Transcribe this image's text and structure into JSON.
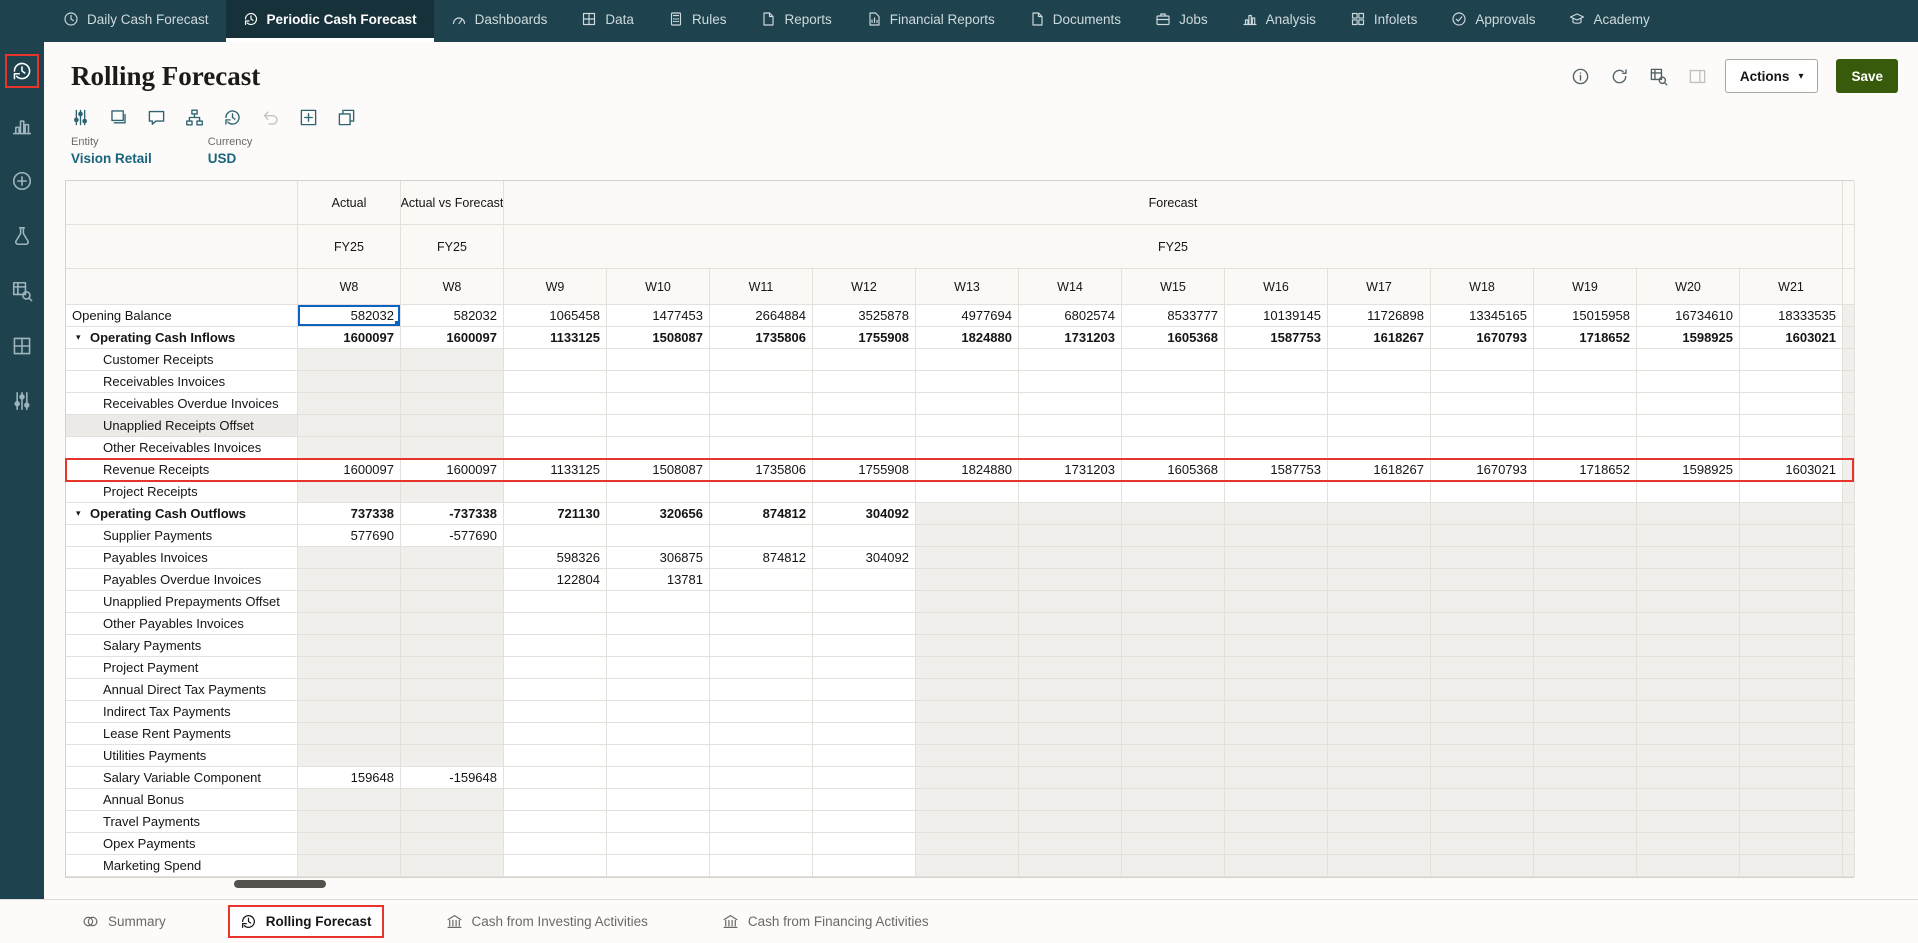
{
  "top_nav": {
    "tabs": [
      {
        "label": "Daily Cash Forecast",
        "icon": "daily-cash-clock"
      },
      {
        "label": "Periodic Cash Forecast",
        "icon": "periodic-cycle",
        "active": true
      },
      {
        "label": "Dashboards",
        "icon": "dashboards-gauge"
      },
      {
        "label": "Data",
        "icon": "data-grid"
      },
      {
        "label": "Rules",
        "icon": "rules-calculator"
      },
      {
        "label": "Reports",
        "icon": "reports-doc"
      },
      {
        "label": "Financial Reports",
        "icon": "financial-reports"
      },
      {
        "label": "Documents",
        "icon": "documents-doc"
      },
      {
        "label": "Jobs",
        "icon": "jobs-briefcase"
      },
      {
        "label": "Analysis",
        "icon": "analysis-chart"
      },
      {
        "label": "Infolets",
        "icon": "infolets-grid"
      },
      {
        "label": "Approvals",
        "icon": "approvals-check"
      },
      {
        "label": "Academy",
        "icon": "academy-cap"
      }
    ]
  },
  "rail": {
    "items": [
      {
        "icon": "rolling-forecast",
        "annotated": true
      },
      {
        "icon": "bar-chart"
      },
      {
        "icon": "data-plus"
      },
      {
        "icon": "rules-flask"
      },
      {
        "icon": "analysis-search"
      },
      {
        "icon": "table-grid"
      },
      {
        "icon": "tools-sliders"
      }
    ]
  },
  "header": {
    "title": "Rolling Forecast",
    "actions_label": "Actions",
    "save_label": "Save",
    "icons": [
      {
        "icon": "info"
      },
      {
        "icon": "refresh"
      },
      {
        "icon": "data-validation"
      },
      {
        "icon": "side-panel",
        "disabled": true
      }
    ]
  },
  "toolbar": {
    "icons": [
      {
        "icon": "adjust-columns"
      },
      {
        "icon": "layers"
      },
      {
        "icon": "comment"
      },
      {
        "icon": "hierarchy"
      },
      {
        "icon": "history"
      },
      {
        "icon": "undo",
        "disabled": true
      },
      {
        "icon": "expand-grid"
      },
      {
        "icon": "open-window"
      }
    ]
  },
  "pov": {
    "entity_label": "Entity",
    "entity_value": "Vision Retail",
    "currency_label": "Currency",
    "currency_value": "USD"
  },
  "grid": {
    "group_headers": {
      "actual": "Actual",
      "avf": "Actual vs Forecast",
      "forecast": "Forecast"
    },
    "year_row": {
      "actual": "FY25",
      "avf": "FY25",
      "forecast": "FY25"
    },
    "week_headers": [
      "W8",
      "W8",
      "W9",
      "W10",
      "W11",
      "W12",
      "W13",
      "W14",
      "W15",
      "W16",
      "W17",
      "W18",
      "W19",
      "W20",
      "W21"
    ],
    "rows": [
      {
        "label": "Opening Balance",
        "level": 0,
        "parent": false,
        "section": "balance",
        "selected_col": 0,
        "values": [
          "582032",
          "582032",
          "1065458",
          "1477453",
          "2664884",
          "3525878",
          "4977694",
          "6802574",
          "8533777",
          "10139145",
          "11726898",
          "13345165",
          "15015958",
          "16734610",
          "18333535"
        ]
      },
      {
        "label": "Operating Cash Inflows",
        "level": 0,
        "parent": true,
        "section": "inflow",
        "values": [
          "1600097",
          "1600097",
          "1133125",
          "1508087",
          "1735806",
          "1755908",
          "1824880",
          "1731203",
          "1605368",
          "1587753",
          "1618267",
          "1670793",
          "1718652",
          "1598925",
          "1603021"
        ]
      },
      {
        "label": "Customer Receipts",
        "level": 1,
        "parent": false,
        "section": "inflow",
        "values": []
      },
      {
        "label": "Receivables Invoices",
        "level": 1,
        "parent": false,
        "section": "inflow",
        "values": []
      },
      {
        "label": "Receivables Overdue Invoices",
        "level": 1,
        "parent": false,
        "section": "inflow",
        "values": []
      },
      {
        "label": "Unapplied Receipts Offset",
        "level": 1,
        "parent": false,
        "section": "inflow",
        "label_shaded": true,
        "values": []
      },
      {
        "label": "Other Receivables Invoices",
        "level": 1,
        "parent": false,
        "section": "inflow",
        "values": []
      },
      {
        "label": "Revenue Receipts",
        "level": 1,
        "parent": false,
        "section": "inflow",
        "annotated": true,
        "values": [
          "1600097",
          "1600097",
          "1133125",
          "1508087",
          "1735806",
          "1755908",
          "1824880",
          "1731203",
          "1605368",
          "1587753",
          "1618267",
          "1670793",
          "1718652",
          "1598925",
          "1603021"
        ]
      },
      {
        "label": "Project Receipts",
        "level": 1,
        "parent": false,
        "section": "inflow",
        "values": []
      },
      {
        "label": "Operating Cash Outflows",
        "level": 0,
        "parent": true,
        "section": "outflow",
        "values": [
          "737338",
          "-737338",
          "721130",
          "320656",
          "874812",
          "304092"
        ]
      },
      {
        "label": "Supplier Payments",
        "level": 1,
        "parent": false,
        "section": "outflow",
        "values": [
          "577690",
          "-577690"
        ]
      },
      {
        "label": "Payables Invoices",
        "level": 1,
        "parent": false,
        "section": "outflow",
        "values": [
          "",
          "",
          "598326",
          "306875",
          "874812",
          "304092"
        ]
      },
      {
        "label": "Payables Overdue Invoices",
        "level": 1,
        "parent": false,
        "section": "outflow",
        "values": [
          "",
          "",
          "122804",
          "13781"
        ]
      },
      {
        "label": "Unapplied Prepayments Offset",
        "level": 1,
        "parent": false,
        "section": "outflow",
        "values": []
      },
      {
        "label": "Other Payables Invoices",
        "level": 1,
        "parent": false,
        "section": "outflow",
        "values": []
      },
      {
        "label": "Salary Payments",
        "level": 1,
        "parent": false,
        "section": "outflow",
        "values": []
      },
      {
        "label": "Project Payment",
        "level": 1,
        "parent": false,
        "section": "outflow",
        "values": []
      },
      {
        "label": "Annual Direct Tax Payments",
        "level": 1,
        "parent": false,
        "section": "outflow",
        "values": []
      },
      {
        "label": "Indirect Tax Payments",
        "level": 1,
        "parent": false,
        "section": "outflow",
        "values": []
      },
      {
        "label": "Lease Rent Payments",
        "level": 1,
        "parent": false,
        "section": "outflow",
        "values": []
      },
      {
        "label": "Utilities Payments",
        "level": 1,
        "parent": false,
        "section": "outflow",
        "values": []
      },
      {
        "label": "Salary Variable Component",
        "level": 1,
        "parent": false,
        "section": "outflow",
        "values": [
          "159648",
          "-159648"
        ]
      },
      {
        "label": "Annual Bonus",
        "level": 1,
        "parent": false,
        "section": "outflow",
        "values": []
      },
      {
        "label": "Travel Payments",
        "level": 1,
        "parent": false,
        "section": "outflow",
        "values": []
      },
      {
        "label": "Opex Payments",
        "level": 1,
        "parent": false,
        "section": "outflow",
        "values": []
      },
      {
        "label": "Marketing Spend",
        "level": 1,
        "parent": false,
        "section": "outflow",
        "values": []
      }
    ]
  },
  "bottom_tabs": [
    {
      "label": "Summary",
      "icon": "summary-venn"
    },
    {
      "label": "Rolling Forecast",
      "icon": "rolling-forecast",
      "active": true,
      "annotated": true
    },
    {
      "label": "Cash from Investing Activities",
      "icon": "cash-flow"
    },
    {
      "label": "Cash from Financing Activities",
      "icon": "cash-flow"
    }
  ],
  "colors": {
    "nav_bg": "#1e424e",
    "accent_red": "#e8352b",
    "selection_blue": "#0b64c4",
    "save_green": "#375a0b",
    "link_teal": "#19647a"
  }
}
